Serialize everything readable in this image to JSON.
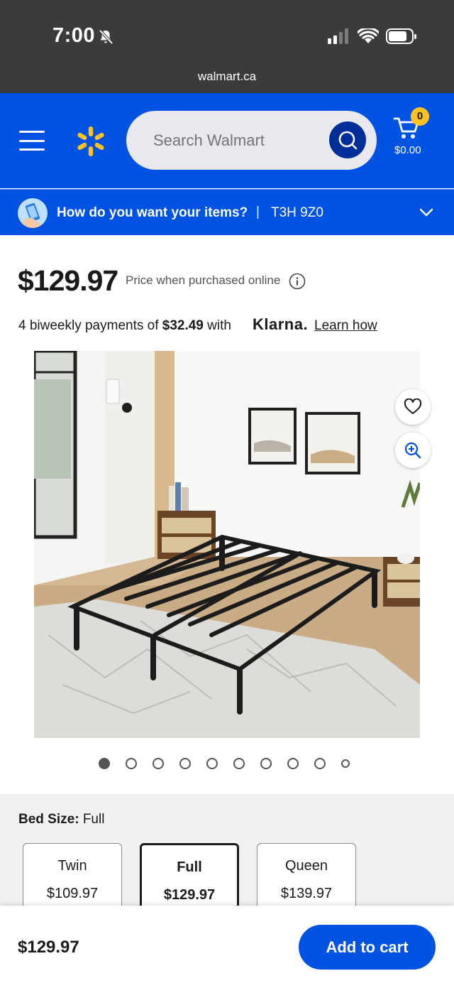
{
  "status_bar": {
    "time": "7:00",
    "url": "walmart.ca"
  },
  "header": {
    "search_placeholder": "Search Walmart",
    "cart_count": "0",
    "cart_total": "$0.00",
    "brand_color": "#0053e2",
    "spark_color": "#ffc220"
  },
  "intent_bar": {
    "question": "How do you want your items?",
    "separator": "|",
    "postal_code": "T3H 9Z0"
  },
  "product": {
    "price": "$129.97",
    "price_note": "Price when purchased online",
    "klarna_prefix": "4 biweekly payments of ",
    "klarna_amount": "$32.49",
    "klarna_suffix": " with",
    "klarna_brand": "Klarna.",
    "learn_how": "Learn how",
    "image_count": 10,
    "active_image": 1
  },
  "bed_size": {
    "label": "Bed Size:",
    "selected": "Full",
    "options": [
      {
        "name": "Twin",
        "price": "$109.97"
      },
      {
        "name": "Full",
        "price": "$129.97"
      },
      {
        "name": "Queen",
        "price": "$139.97"
      }
    ]
  },
  "bottom_bar": {
    "price": "$129.97",
    "add_to_cart": "Add to cart"
  }
}
